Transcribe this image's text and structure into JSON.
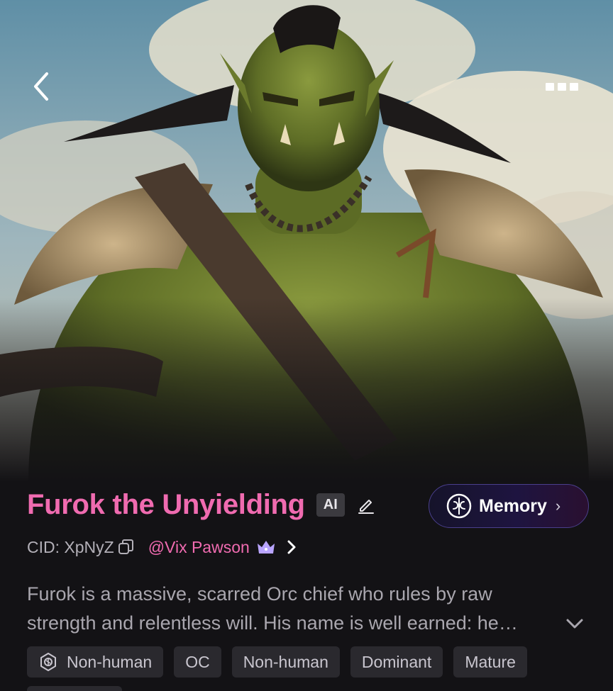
{
  "header": {
    "back_icon": "chevron-left-icon",
    "more_icon": "ellipsis-icon"
  },
  "character": {
    "name": "Furok the Unyielding",
    "ai_badge": "AI",
    "edit_icon": "pencil-icon",
    "cid": "CID: XpNyZ",
    "author": "@Vix Pawson",
    "description": "Furok is a massive, scarred Orc chief who rules by raw strength and relentless will. His name is well earned: he…"
  },
  "memory": {
    "label": "Memory",
    "icon": "brain-icon"
  },
  "tags": [
    {
      "label": "Non-human",
      "icon": "brain-circuit-icon"
    },
    {
      "label": "OC"
    },
    {
      "label": "Non-human"
    },
    {
      "label": "Dominant"
    },
    {
      "label": "Mature"
    }
  ],
  "colors": {
    "accent_pink": "#f06bb0",
    "background": "#131215",
    "tag_bg": "#2a292e",
    "memory_border": "#4a3f8c"
  }
}
